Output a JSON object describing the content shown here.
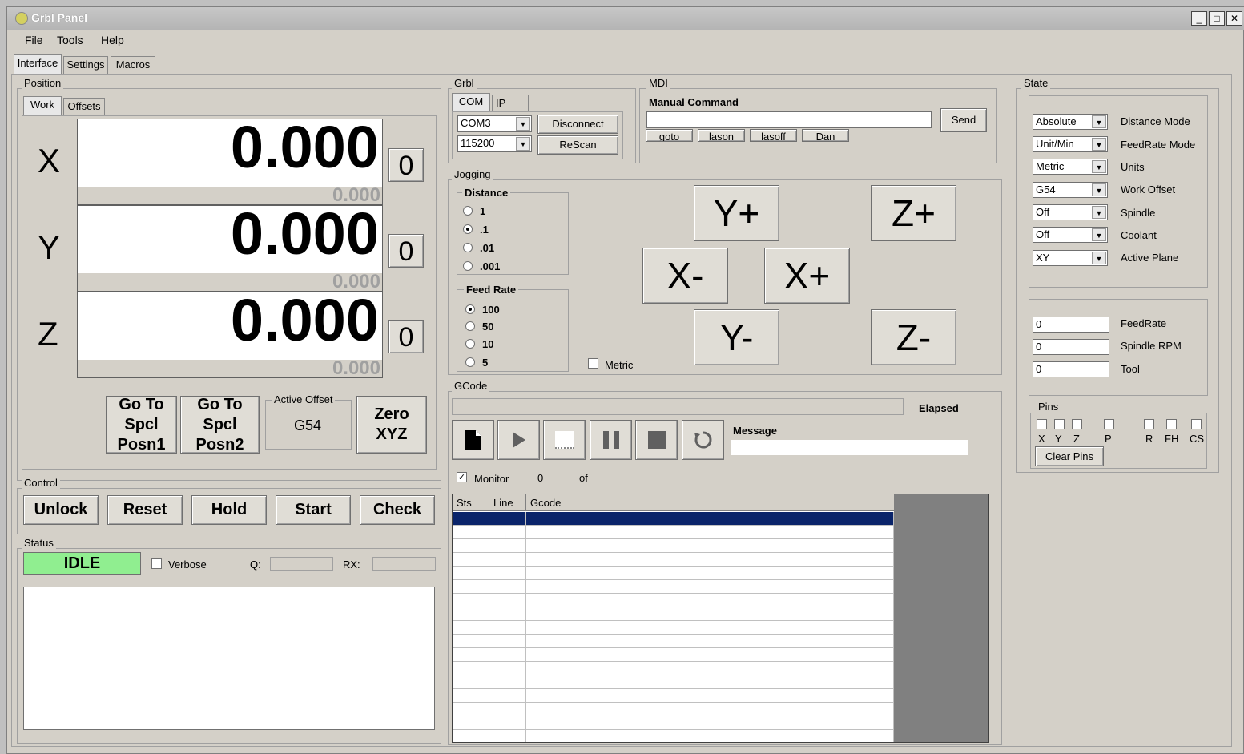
{
  "window": {
    "title": "Grbl Panel",
    "min": "_",
    "max": "□",
    "close": "✕"
  },
  "menu": [
    "File",
    "Tools",
    "Help"
  ],
  "main_tabs": [
    "Interface",
    "Settings",
    "Macros"
  ],
  "position": {
    "label": "Position",
    "tabs": [
      "Work",
      "Offsets"
    ],
    "axes": [
      {
        "name": "X",
        "work": "0.000",
        "machine": "0.000",
        "zero": "0"
      },
      {
        "name": "Y",
        "work": "0.000",
        "machine": "0.000",
        "zero": "0"
      },
      {
        "name": "Z",
        "work": "0.000",
        "machine": "0.000",
        "zero": "0"
      }
    ],
    "goto1": [
      "Go To",
      "Spcl",
      "Posn1"
    ],
    "goto2": [
      "Go To",
      "Spcl",
      "Posn2"
    ],
    "active_offset_label": "Active Offset",
    "active_offset_value": "G54",
    "zero_xyz": [
      "Zero",
      "XYZ"
    ]
  },
  "control": {
    "label": "Control",
    "buttons": [
      "Unlock",
      "Reset",
      "Hold",
      "Start",
      "Check"
    ]
  },
  "status": {
    "label": "Status",
    "state": "IDLE",
    "verbose": "Verbose",
    "q": "Q:",
    "rx": "RX:"
  },
  "grbl": {
    "label": "Grbl",
    "tabs": [
      "COM",
      "IP"
    ],
    "port": "COM3",
    "baud": "115200",
    "disconnect": "Disconnect",
    "rescan": "ReScan"
  },
  "mdi": {
    "label": "MDI",
    "manual": "Manual Command",
    "send": "Send",
    "macros": [
      "goto",
      "lason",
      "lasoff",
      "Dan"
    ]
  },
  "jogging": {
    "label": "Jogging",
    "distance_label": "Distance",
    "distances": [
      "1",
      ".1",
      ".01",
      ".001"
    ],
    "distance_selected": 1,
    "feed_label": "Feed Rate",
    "feeds": [
      "100",
      "50",
      "10",
      "5"
    ],
    "feed_selected": 0,
    "metric": "Metric",
    "buttons": {
      "yplus": "Y+",
      "zplus": "Z+",
      "xminus": "X-",
      "xplus": "X+",
      "yminus": "Y-",
      "zminus": "Z-"
    }
  },
  "gcode": {
    "label": "GCode",
    "elapsed": "Elapsed",
    "message": "Message",
    "monitor": "Monitor",
    "count": "0",
    "of": "of",
    "columns": [
      "Sts",
      "Line",
      "Gcode"
    ]
  },
  "state": {
    "label": "State",
    "modes": [
      {
        "value": "Absolute",
        "label": "Distance Mode"
      },
      {
        "value": "Unit/Min",
        "label": "FeedRate Mode"
      },
      {
        "value": "Metric",
        "label": "Units"
      },
      {
        "value": "G54",
        "label": "Work Offset"
      },
      {
        "value": "Off",
        "label": "Spindle"
      },
      {
        "value": "Off",
        "label": "Coolant"
      },
      {
        "value": "XY",
        "label": "Active Plane"
      }
    ],
    "values": [
      {
        "value": "0",
        "label": "FeedRate"
      },
      {
        "value": "0",
        "label": "Spindle RPM"
      },
      {
        "value": "0",
        "label": "Tool"
      }
    ],
    "pins_label": "Pins",
    "pins": [
      "X",
      "Y",
      "Z",
      "P",
      "R",
      "FH",
      "CS"
    ],
    "clear_pins": "Clear Pins"
  },
  "colors": {
    "idle": "#90ee90",
    "selected_row": "#0a246a",
    "grid_bg": "#808080"
  }
}
